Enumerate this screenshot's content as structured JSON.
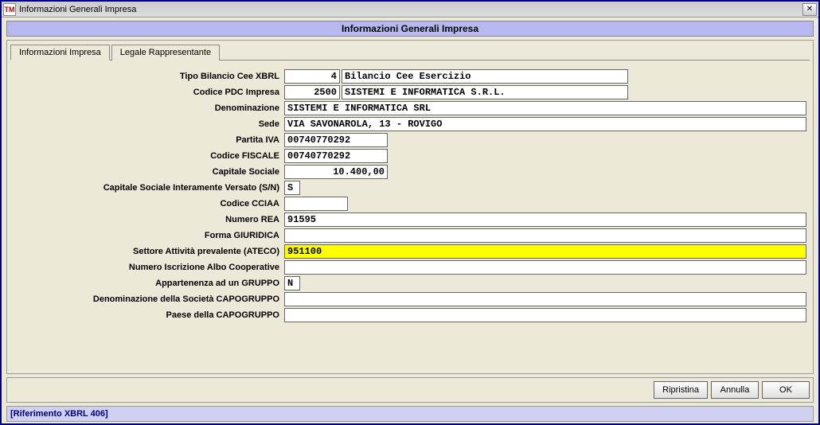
{
  "window": {
    "title": "Informazioni Generali Impresa",
    "icon_text": "TM",
    "close_label": "✕"
  },
  "header": {
    "title": "Informazioni Generali Impresa"
  },
  "tabs": {
    "t1": "Informazioni Impresa",
    "t2": "Legale Rappresentante"
  },
  "labels": {
    "tipo_bilancio": "Tipo Bilancio Cee XBRL",
    "codice_pdc": "Codice PDC Impresa",
    "denominazione": "Denominazione",
    "sede": "Sede",
    "partita_iva": "Partita IVA",
    "codice_fiscale": "Codice FISCALE",
    "capitale_sociale": "Capitale Sociale",
    "capitale_versato": "Capitale Sociale Interamente Versato (S/N)",
    "codice_cciaa": "Codice CCIAA",
    "numero_rea": "Numero REA",
    "forma_giuridica": "Forma GIURIDICA",
    "settore_ateco": "Settore Attività prevalente (ATECO)",
    "numero_albo": "Numero Iscrizione Albo Cooperative",
    "appartenenza_gruppo": "Appartenenza ad un GRUPPO",
    "denom_capogruppo": "Denominazione della Società CAPOGRUPPO",
    "paese_capogruppo": "Paese della CAPOGRUPPO"
  },
  "values": {
    "tipo_bilancio_code": "4",
    "tipo_bilancio_desc": "Bilancio Cee Esercizio",
    "codice_pdc_code": "2500",
    "codice_pdc_desc": "SISTEMI E INFORMATICA S.R.L.",
    "denominazione": "SISTEMI E INFORMATICA SRL",
    "sede": "VIA SAVONAROLA, 13 - ROVIGO",
    "partita_iva": "00740770292",
    "codice_fiscale": "00740770292",
    "capitale_sociale": "10.400,00",
    "capitale_versato": "S",
    "codice_cciaa": "",
    "numero_rea": "91595",
    "forma_giuridica": "",
    "settore_ateco": "951100",
    "numero_albo": "",
    "appartenenza_gruppo": "N",
    "denom_capogruppo": "",
    "paese_capogruppo": ""
  },
  "buttons": {
    "ripristina": "Ripristina",
    "annulla": "Annulla",
    "ok": "OK"
  },
  "status": {
    "text": "[Riferimento XBRL 406]"
  }
}
